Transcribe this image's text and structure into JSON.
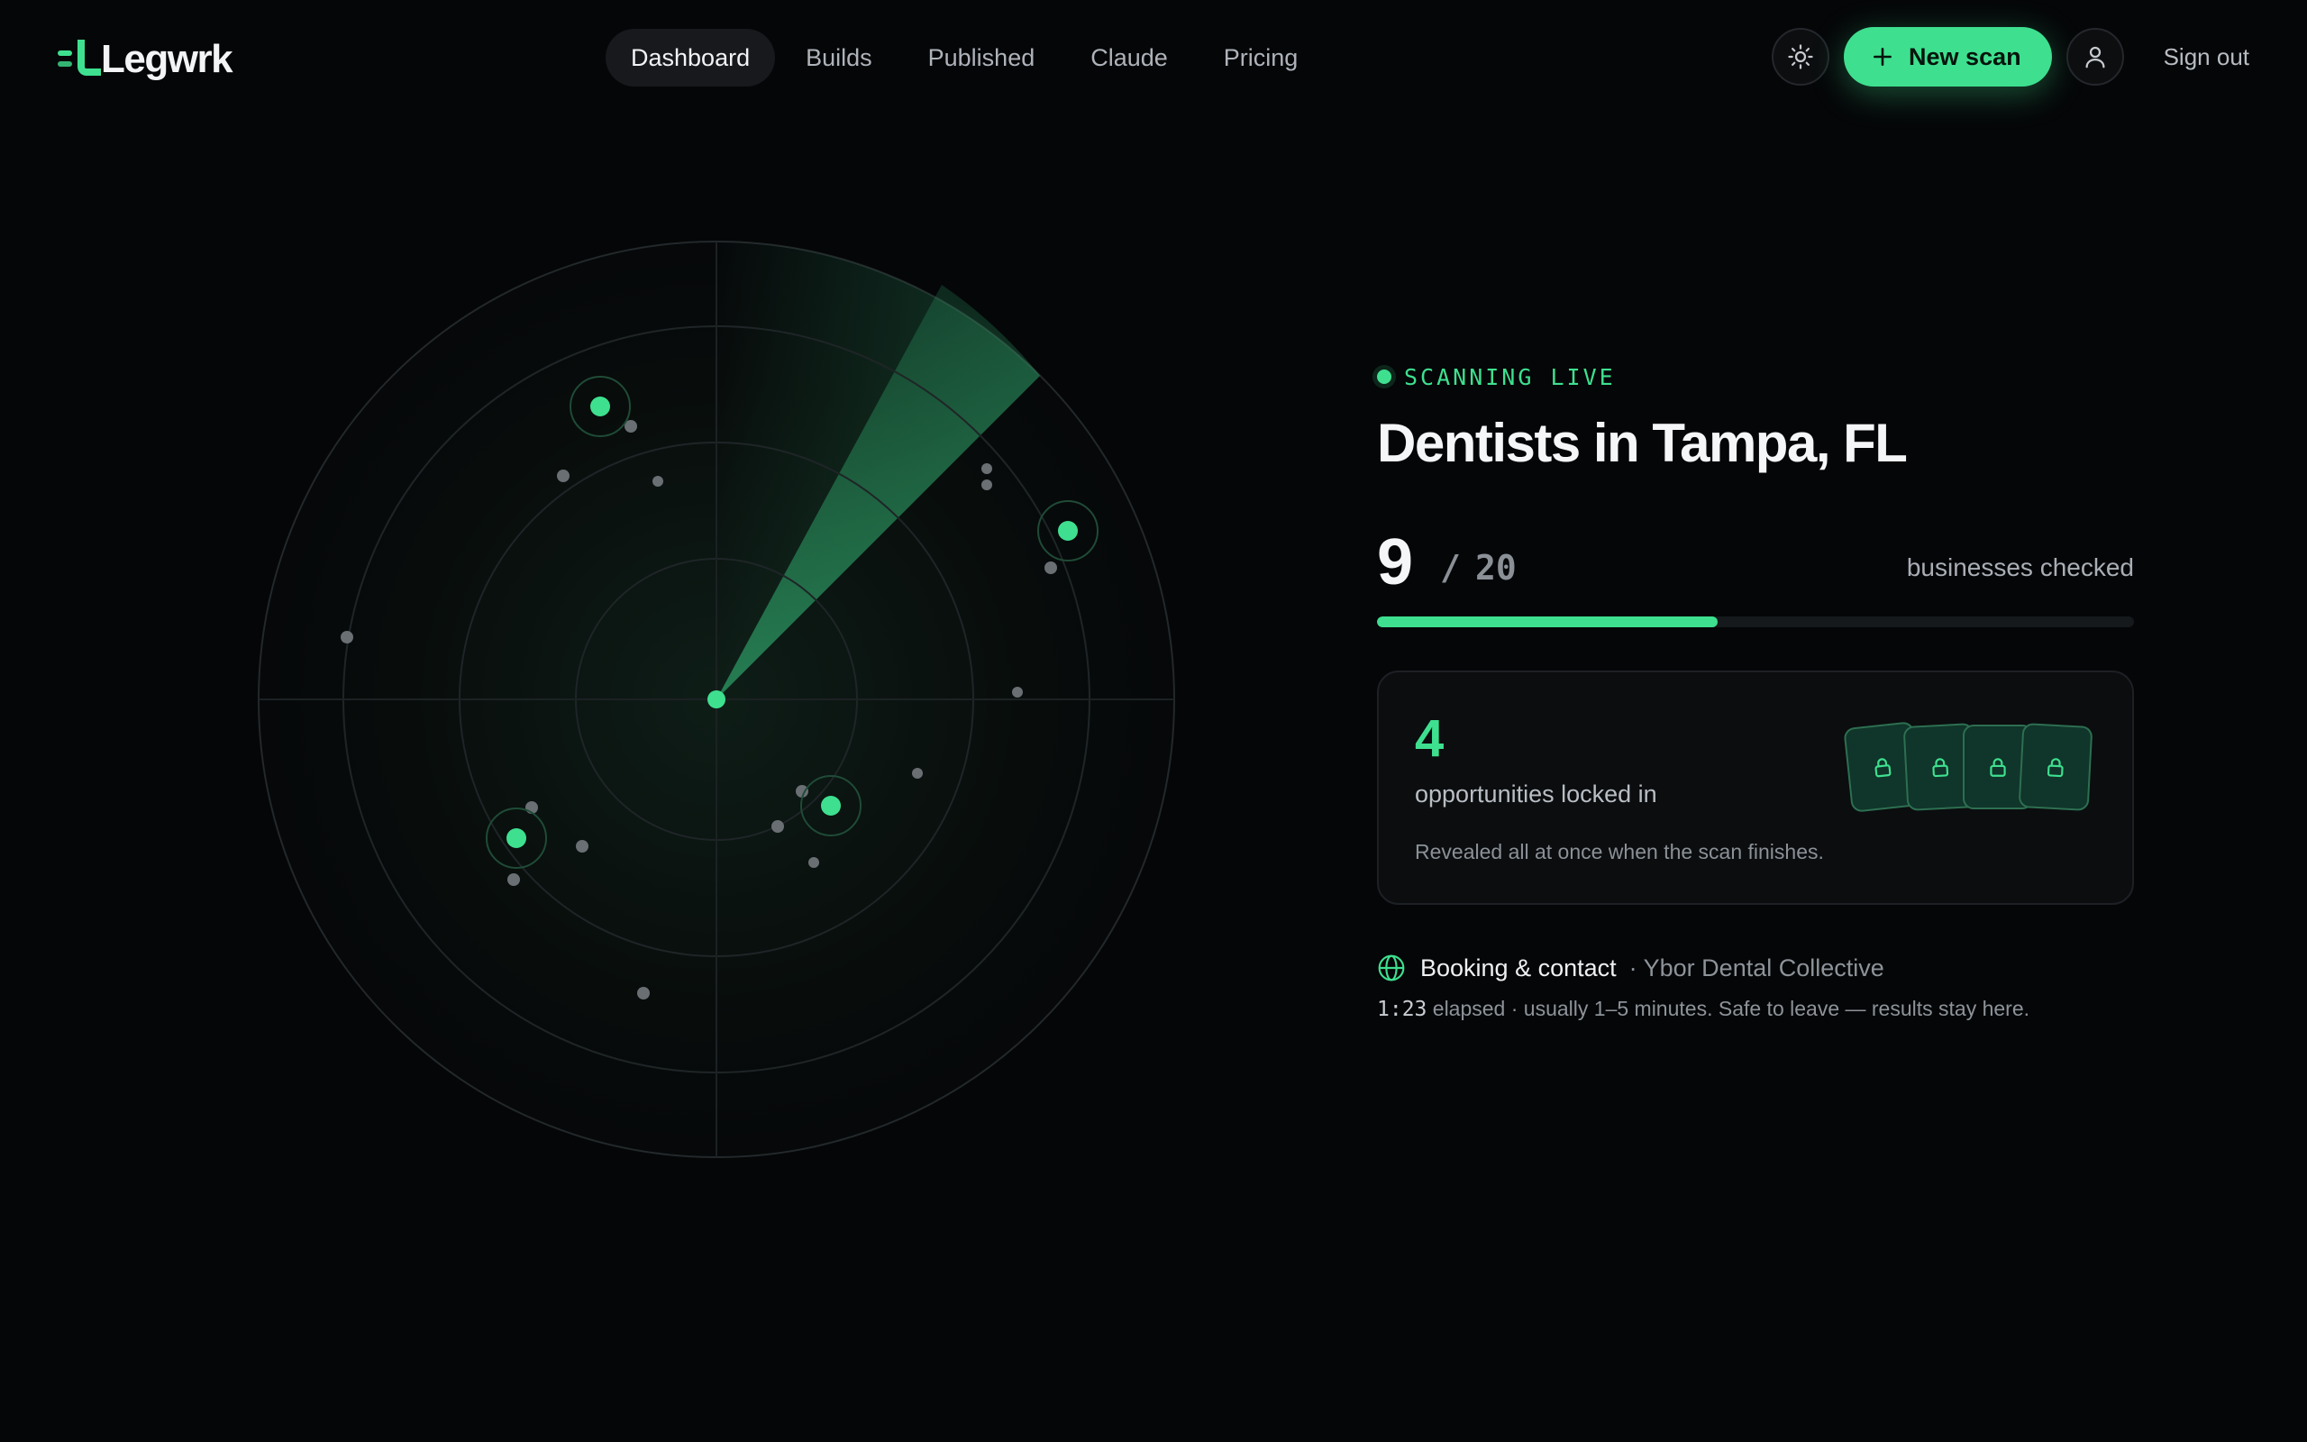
{
  "app": {
    "brand": "Legwrk"
  },
  "nav": {
    "items": [
      {
        "label": "Dashboard",
        "active": true
      },
      {
        "label": "Builds",
        "active": false
      },
      {
        "label": "Published",
        "active": false
      },
      {
        "label": "Claude",
        "active": false
      },
      {
        "label": "Pricing",
        "active": false
      }
    ]
  },
  "header": {
    "theme_icon": "sun-icon",
    "new_scan_label": "New scan",
    "new_scan_icon": "plus-icon",
    "account_icon": "user-icon",
    "sign_out_label": "Sign out"
  },
  "scan": {
    "status": "SCANNING LIVE",
    "title": "Dentists in Tampa, FL",
    "checked": "9",
    "separator": "/",
    "total": "20",
    "checked_label": "businesses checked",
    "progress_fraction": 0.45
  },
  "opportunities": {
    "count": "4",
    "label": "opportunities locked in",
    "note": "Revealed all at once when the scan finishes.",
    "locked_cards": 4,
    "lock_icon": "lock-icon"
  },
  "activity": {
    "icon": "globe-icon",
    "label": "Booking & contact",
    "business": "· Ybor Dental Collective",
    "elapsed": "1:23",
    "elapsed_note": "elapsed · usually 1–5 minutes. Safe to leave — results stay here."
  },
  "colors": {
    "accent": "#3ee08f",
    "background": "#050608",
    "card": "#0b0d0f",
    "muted_text": "#8d9399"
  }
}
